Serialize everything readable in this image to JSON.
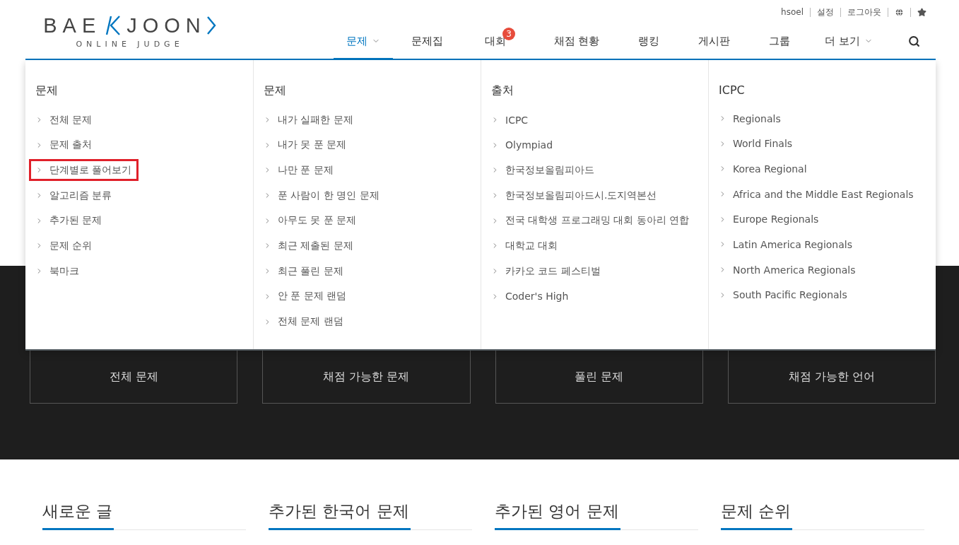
{
  "logo": {
    "left": "BAE",
    "right": "JOON",
    "subtitle": "ONLINE JUDGE"
  },
  "top_links": [
    {
      "kind": "text",
      "label": "hsoel"
    },
    {
      "kind": "text",
      "label": "설정"
    },
    {
      "kind": "text",
      "label": "로그아웃"
    },
    {
      "kind": "globe"
    },
    {
      "kind": "star"
    }
  ],
  "nav": [
    {
      "label": "문제",
      "selected": true,
      "caret": true
    },
    {
      "label": "문제집",
      "selected": false,
      "caret": false
    },
    {
      "label": "대회",
      "selected": false,
      "caret": false,
      "badge": "3"
    },
    {
      "label": "채점 현황",
      "selected": false,
      "caret": false
    },
    {
      "label": "랭킹",
      "selected": false,
      "caret": false
    },
    {
      "label": "게시판",
      "selected": false,
      "caret": false
    },
    {
      "label": "그룹",
      "selected": false,
      "caret": false
    },
    {
      "label": "더 보기",
      "selected": false,
      "caret": true
    }
  ],
  "dropdown": [
    {
      "title": "문제",
      "items": [
        {
          "label": "전체 문제",
          "highlighted": false
        },
        {
          "label": "문제 출처",
          "highlighted": false
        },
        {
          "label": "단계별로 풀어보기",
          "highlighted": true
        },
        {
          "label": "알고리즘 분류",
          "highlighted": false
        },
        {
          "label": "추가된 문제",
          "highlighted": false
        },
        {
          "label": "문제 순위",
          "highlighted": false
        },
        {
          "label": "북마크",
          "highlighted": false
        }
      ]
    },
    {
      "title": "문제",
      "items": [
        {
          "label": "내가 실패한 문제",
          "highlighted": false
        },
        {
          "label": "내가 못 푼 문제",
          "highlighted": false
        },
        {
          "label": "나만 푼 문제",
          "highlighted": false
        },
        {
          "label": "푼 사람이 한 명인 문제",
          "highlighted": false
        },
        {
          "label": "아무도 못 푼 문제",
          "highlighted": false
        },
        {
          "label": "최근 제출된 문제",
          "highlighted": false
        },
        {
          "label": "최근 풀린 문제",
          "highlighted": false
        },
        {
          "label": "안 푼 문제 랜덤",
          "highlighted": false
        },
        {
          "label": "전체 문제 랜덤",
          "highlighted": false
        }
      ]
    },
    {
      "title": "출처",
      "items": [
        {
          "label": "ICPC",
          "highlighted": false
        },
        {
          "label": "Olympiad",
          "highlighted": false
        },
        {
          "label": "한국정보올림피아드",
          "highlighted": false
        },
        {
          "label": "한국정보올림피아드시.도지역본선",
          "highlighted": false
        },
        {
          "label": "전국 대학생 프로그래밍 대회 동아리 연합",
          "highlighted": false
        },
        {
          "label": "대학교 대회",
          "highlighted": false
        },
        {
          "label": "카카오 코드 페스티벌",
          "highlighted": false
        },
        {
          "label": "Coder's High",
          "highlighted": false
        }
      ]
    },
    {
      "title": "ICPC",
      "items": [
        {
          "label": "Regionals",
          "highlighted": false
        },
        {
          "label": "World Finals",
          "highlighted": false
        },
        {
          "label": "Korea Regional",
          "highlighted": false
        },
        {
          "label": "Africa and the Middle East Regionals",
          "highlighted": false
        },
        {
          "label": "Europe Regionals",
          "highlighted": false
        },
        {
          "label": "Latin America Regionals",
          "highlighted": false
        },
        {
          "label": "North America Regionals",
          "highlighted": false
        },
        {
          "label": "South Pacific Regionals",
          "highlighted": false
        }
      ]
    }
  ],
  "stats": [
    {
      "label": "전체 문제"
    },
    {
      "label": "채점 가능한 문제"
    },
    {
      "label": "풀린 문제"
    },
    {
      "label": "채점 가능한 언어"
    }
  ],
  "sections": [
    {
      "title": "새로운 글"
    },
    {
      "title": "추가된 한국어 문제"
    },
    {
      "title": "추가된 영어 문제"
    },
    {
      "title": "문제 순위"
    }
  ]
}
